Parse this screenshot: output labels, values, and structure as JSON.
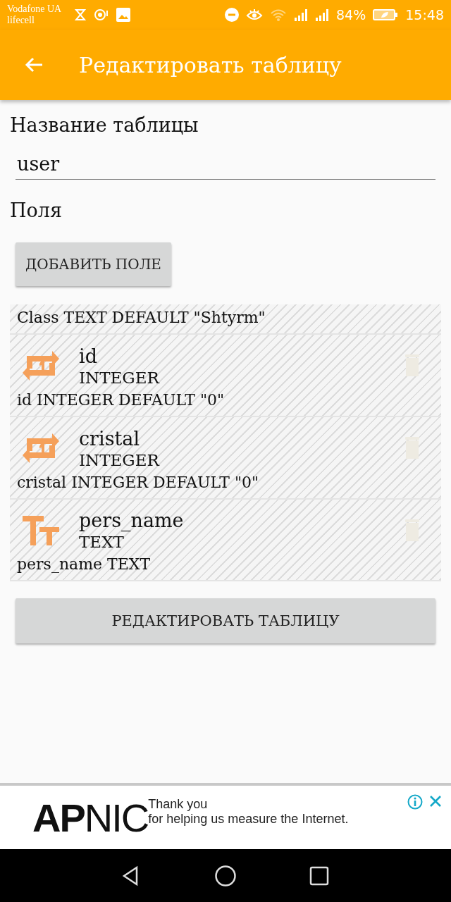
{
  "status_bar": {
    "carrier_1": "Vodafone UA",
    "carrier_2": "lifecell",
    "battery": "84%",
    "time": "15:48"
  },
  "app_bar": {
    "title": "Редактировать таблицу"
  },
  "table_name": {
    "label": "Название таблицы",
    "value": "user"
  },
  "fields_label": "Поля",
  "add_button": "ДОБАВИТЬ ПОЛЕ",
  "fields": [
    {
      "kind": "cut",
      "definition": "Class TEXT DEFAULT \"Shtyrm\""
    },
    {
      "kind": "integer",
      "name": "id",
      "type": "INTEGER",
      "definition": "id INTEGER DEFAULT \"0\""
    },
    {
      "kind": "integer",
      "name": "cristal",
      "type": "INTEGER",
      "definition": "cristal INTEGER DEFAULT \"0\""
    },
    {
      "kind": "text",
      "name": "pers_name",
      "type": "TEXT",
      "definition": "pers_name TEXT"
    }
  ],
  "submit_button": "РЕДАКТИРОВАТЬ ТАБЛИЦУ",
  "ad": {
    "logo": "**AP**NIC",
    "line_1": "Thank you",
    "line_2": "for helping us measure the Internet."
  }
}
